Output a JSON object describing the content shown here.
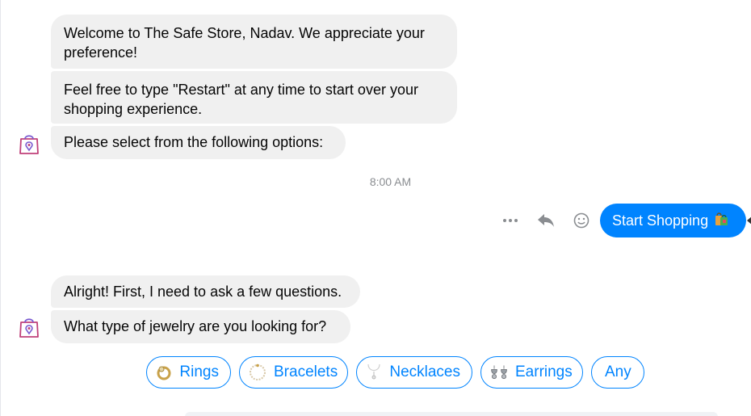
{
  "messages_top": [
    {
      "text": "Welcome to The Safe Store, Nadav. We appreciate your preference!"
    },
    {
      "text": "Feel free to type \"Restart\" at any time to start over your shopping experience."
    },
    {
      "text": "Please select from the following options:"
    }
  ],
  "timestamp": "8:00 AM",
  "outgoing": {
    "text": "Start Shopping",
    "color": "#0084ff"
  },
  "messages_bottom": [
    {
      "text": "Alright! First, I need to ask a few questions."
    },
    {
      "text": "What type of jewelry are you looking for?"
    }
  ],
  "quick_replies": [
    {
      "label": "Rings",
      "icon": "ring-icon"
    },
    {
      "label": "Bracelets",
      "icon": "bracelet-icon"
    },
    {
      "label": "Necklaces",
      "icon": "necklace-icon"
    },
    {
      "label": "Earrings",
      "icon": "earrings-icon"
    },
    {
      "label": "Any",
      "icon": ""
    }
  ],
  "colors": {
    "accent": "#0084ff",
    "bubble": "#f0f0f0",
    "brand_icon": "#c0407a"
  }
}
